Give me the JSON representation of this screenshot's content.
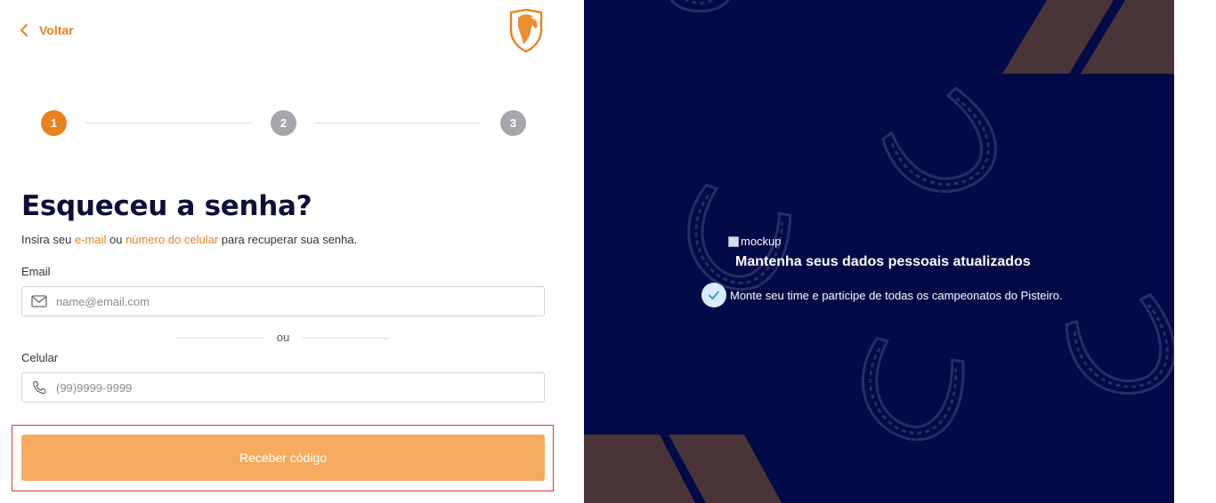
{
  "header": {
    "back_label": "Voltar"
  },
  "stepper": {
    "steps": [
      "1",
      "2",
      "3"
    ],
    "active_step": 1
  },
  "form": {
    "title": "Esqueceu a senha?",
    "subtitle_pre": "Insira seu ",
    "subtitle_email": "e-mail",
    "subtitle_mid": " ou ",
    "subtitle_phone": "número do celular",
    "subtitle_post": " para recuperar sua senha.",
    "email_label": "Email",
    "email_placeholder": "name@email.com",
    "or_label": "ou",
    "phone_label": "Celular",
    "phone_placeholder": "(99)9999-9999",
    "submit_label": "Receber código"
  },
  "promo": {
    "mockup_alt": "mockup",
    "title": "Mantenha seus dados pessoais atualizados",
    "feature_text": "Monte seu time e participe de todas os campeonatos do Pisteiro."
  },
  "colors": {
    "accent": "#e8821c",
    "button": "#f4ab5e",
    "panel_bg": "#020a47",
    "stripe": "#4a3438"
  },
  "icons": {
    "back": "chevron-left-icon",
    "logo": "horse-shield-logo",
    "email": "envelope-icon",
    "phone": "phone-icon",
    "check": "check-icon"
  }
}
